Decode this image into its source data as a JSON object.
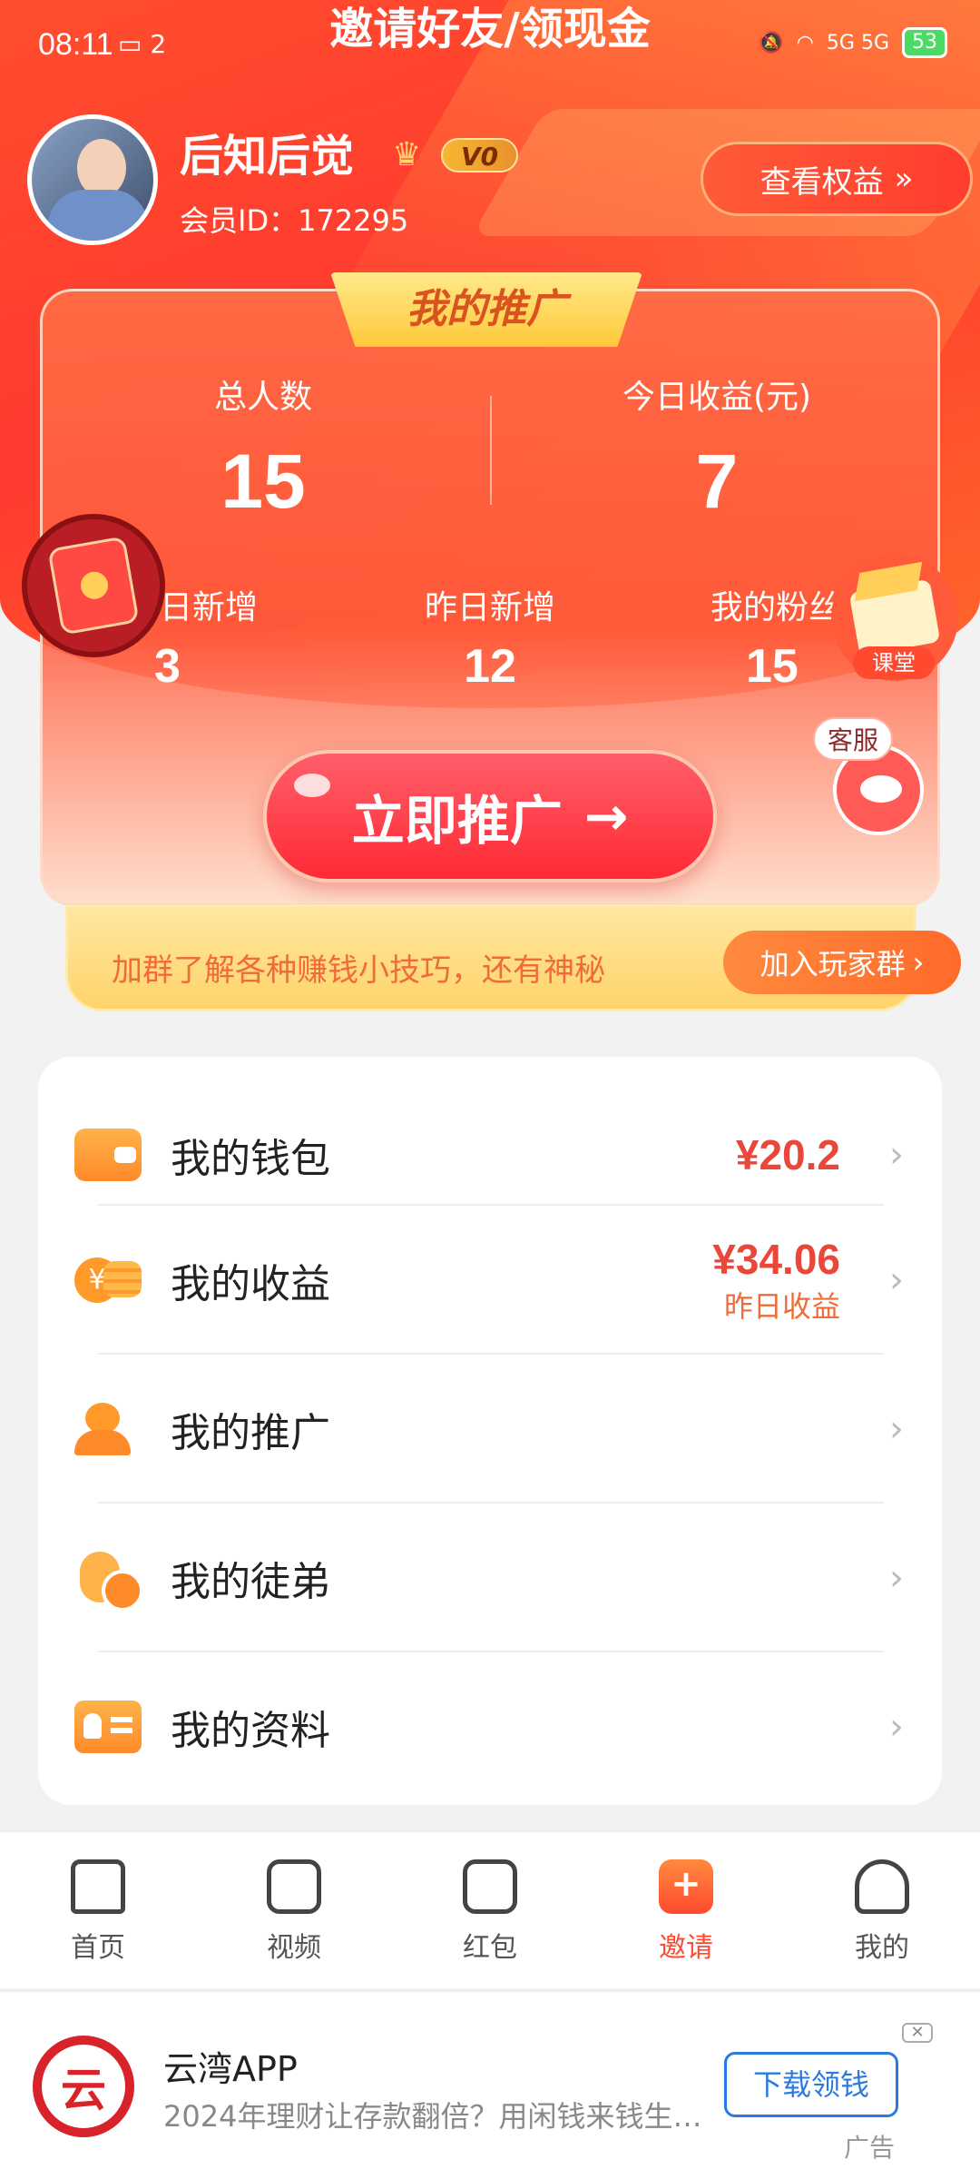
{
  "status_bar": {
    "time": "08:11",
    "notif": "2",
    "network": "5G 5G",
    "battery": "53"
  },
  "page_title": "邀请好友/领现金",
  "user": {
    "name": "后知后觉",
    "vip_level": "V0",
    "member_id": "会员ID：172295",
    "view_rights": "查看权益"
  },
  "promo": {
    "title": "我的推广",
    "total_label": "总人数",
    "total_value": "15",
    "today_income_label": "今日收益(元)",
    "today_income_value": "7",
    "today_new_label": "日新增",
    "today_new_value": "3",
    "yesterday_new_label": "昨日新增",
    "yesterday_new_value": "12",
    "fans_label": "我的粉丝",
    "fans_value": "15",
    "promote_button": "立即推广",
    "tips_text": "加群了解各种赚钱小技巧，还有神秘",
    "join_button": "加入玩家群"
  },
  "floating": {
    "class_label": "课堂",
    "service_label": "客服"
  },
  "menu": {
    "wallet_label": "我的钱包",
    "wallet_value": "¥20.2",
    "income_label": "我的收益",
    "income_value": "¥34.06",
    "income_sub": "昨日收益",
    "promotion_label": "我的推广",
    "disciples_label": "我的徒弟",
    "profile_label": "我的资料"
  },
  "tabs": [
    {
      "label": "首页"
    },
    {
      "label": "视频"
    },
    {
      "label": "红包"
    },
    {
      "label": "邀请"
    },
    {
      "label": "我的"
    }
  ],
  "ad": {
    "title": "云湾APP",
    "desc": "2024年理财让存款翻倍？用闲钱来钱生…",
    "button": "下载领钱",
    "tag": "广告"
  },
  "colors": {
    "brand_red": "#ff3a2f",
    "accent_orange": "#ff8a2a",
    "money_red": "#e8473a",
    "ad_blue": "#2a7ae2"
  }
}
